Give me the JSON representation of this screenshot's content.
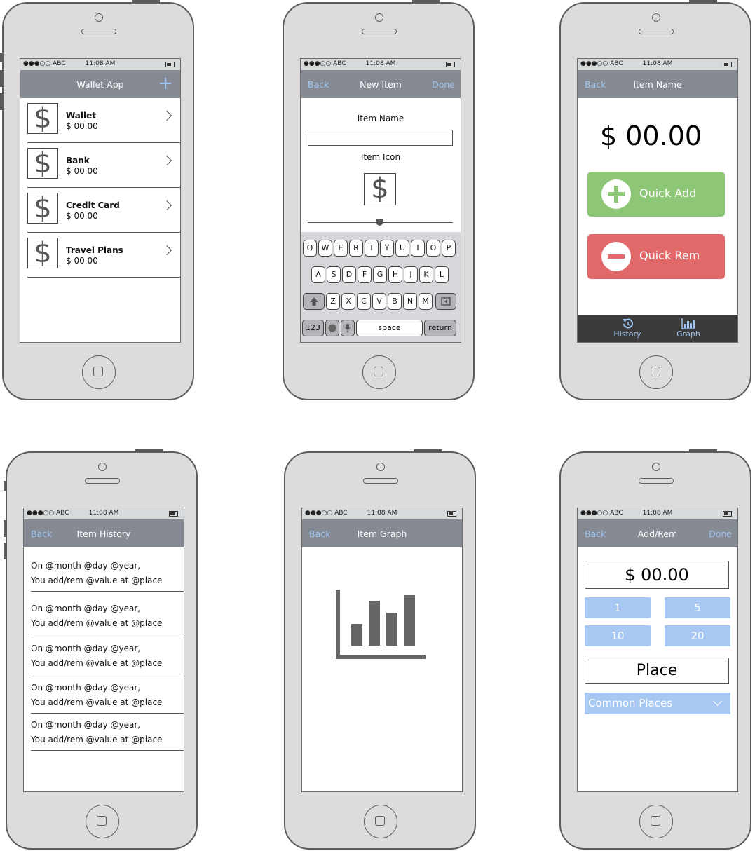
{
  "status_bar": {
    "carrier": "●●●○○ ABC",
    "time": "11:08 AM"
  },
  "screens": {
    "wallet": {
      "title": "Wallet App",
      "add_icon": "plus-icon",
      "items": [
        {
          "name": "Wallet",
          "value": "$ 00.00"
        },
        {
          "name": "Bank",
          "value": "$ 00.00"
        },
        {
          "name": "Credit Card",
          "value": "$ 00.00"
        },
        {
          "name": "Travel Plans",
          "value": "$ 00.00"
        }
      ],
      "dollar_glyph": "$"
    },
    "new_item": {
      "back": "Back",
      "title": "New Item",
      "done": "Done",
      "item_name_label": "Item Name",
      "item_icon_label": "Item Icon",
      "dollar_glyph": "$",
      "keyboard": {
        "row1": [
          "Q",
          "W",
          "E",
          "R",
          "T",
          "Y",
          "U",
          "I",
          "O",
          "P"
        ],
        "row2": [
          "A",
          "S",
          "D",
          "F",
          "G",
          "H",
          "J",
          "K",
          "L"
        ],
        "row3": [
          "Z",
          "X",
          "C",
          "V",
          "B",
          "N",
          "M"
        ],
        "numbers": "123",
        "space": "space",
        "return": "return"
      }
    },
    "item_name": {
      "back": "Back",
      "title": "Item Name",
      "amount": "$ 00.00",
      "quick_add": "Quick Add",
      "quick_rem": "Quick Rem",
      "tab_history": "History",
      "tab_graph": "Graph"
    },
    "history": {
      "back": "Back",
      "title": "Item History",
      "entries": [
        {
          "line1": "On @month @day @year,",
          "line2": "You add/rem @value at @place"
        },
        {
          "line1": "On @month @day @year,",
          "line2": "You add/rem @value at @place"
        },
        {
          "line1": "On @month @day @year,",
          "line2": "You add/rem @value at @place"
        },
        {
          "line1": "On @month @day @year,",
          "line2": "You add/rem @value at @place"
        },
        {
          "line1": "On @month @day @year,",
          "line2": "You add/rem @value at @place"
        }
      ]
    },
    "graph": {
      "back": "Back",
      "title": "Item Graph"
    },
    "add_rem": {
      "back": "Back",
      "title": "Add/Rem",
      "done": "Done",
      "amount": "$ 00.00",
      "buttons": [
        "1",
        "5",
        "10",
        "20"
      ],
      "place": "Place",
      "common_places": "Common Places"
    }
  },
  "colors": {
    "accent": "#9ec5f0",
    "nav": "#868a92",
    "green": "#8ec677",
    "red": "#e1696a",
    "blue_button": "#a6c8f2"
  }
}
